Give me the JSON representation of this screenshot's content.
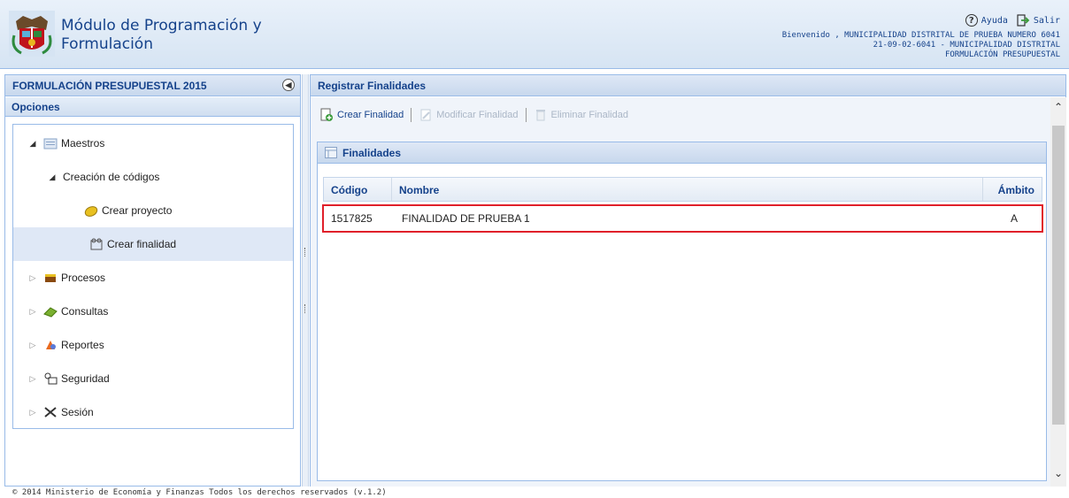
{
  "header": {
    "title": "Módulo de Programación y Formulación",
    "help_label": "Ayuda",
    "exit_label": "Salir",
    "welcome": "Bienvenido , MUNICIPALIDAD DISTRITAL DE PRUEBA NUMERO 6041",
    "entity": "21-09-02-6041 - MUNICIPALIDAD DISTRITAL",
    "stage": "FORMULACIÓN PRESUPUESTAL"
  },
  "left_panel": {
    "title": "FORMULACIÓN PRESUPUESTAL 2015",
    "options_title": "Opciones",
    "tree": {
      "maestros": "Maestros",
      "creacion_codigos": "Creación de códigos",
      "crear_proyecto": "Crear proyecto",
      "crear_finalidad": "Crear finalidad",
      "procesos": "Procesos",
      "consultas": "Consultas",
      "reportes": "Reportes",
      "seguridad": "Seguridad",
      "sesion": "Sesión"
    }
  },
  "right_panel": {
    "title": "Registrar Finalidades",
    "toolbar": {
      "create": "Crear Finalidad",
      "modify": "Modificar Finalidad",
      "delete": "Eliminar Finalidad"
    },
    "grid": {
      "title": "Finalidades",
      "columns": [
        "Código",
        "Nombre",
        "Ámbito"
      ],
      "rows": [
        {
          "codigo": "1517825",
          "nombre": "FINALIDAD DE PRUEBA 1",
          "ambito": "A"
        }
      ]
    }
  },
  "footer": "© 2014 Ministerio de Economía y Finanzas Todos los derechos reservados (v.1.2)",
  "colors": {
    "accent": "#15428b",
    "border": "#99bbe8",
    "highlight": "#e0202a"
  }
}
